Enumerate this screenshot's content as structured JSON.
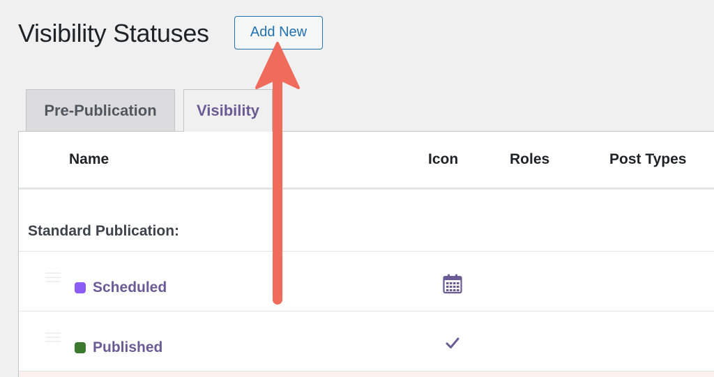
{
  "header": {
    "title": "Visibility Statuses",
    "add_new_label": "Add New"
  },
  "tabs": [
    {
      "label": "Pre-Publication",
      "active": false
    },
    {
      "label": "Visibility",
      "active": true
    }
  ],
  "table": {
    "columns": [
      "Name",
      "Icon",
      "Roles",
      "Post Types"
    ],
    "group_label": "Standard Publication:",
    "rows": [
      {
        "name": "Scheduled",
        "color": "#8b5cf6",
        "icon": "calendar-icon"
      },
      {
        "name": "Published",
        "color": "#3b7a2e",
        "icon": "checkmark-icon"
      }
    ]
  },
  "colors": {
    "accent_link": "#2271b1",
    "status_text": "#6b5b95",
    "arrow": "#ef6b5b"
  }
}
